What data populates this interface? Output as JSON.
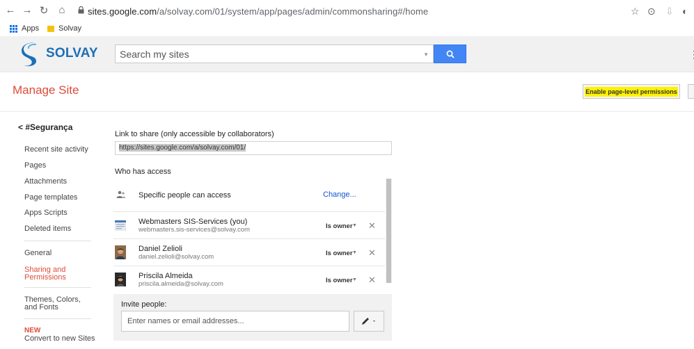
{
  "browser": {
    "url_host": "sites.google.com",
    "url_path": "/a/solvay.com/01/system/app/pages/admin/commonsharing#/home",
    "bookmarks": [
      {
        "label": "Apps"
      },
      {
        "label": "Solvay"
      }
    ]
  },
  "header": {
    "brand": "SOLVAY",
    "search_placeholder": "Search my sites"
  },
  "page": {
    "title": "Manage Site",
    "enable_permissions_label": "Enable page-level permissions"
  },
  "sidebar": {
    "back_label": "< #Segurança",
    "groups": [
      [
        "Recent site activity",
        "Pages",
        "Attachments",
        "Page templates",
        "Apps Scripts",
        "Deleted items"
      ],
      [
        "General",
        "Sharing and Permissions"
      ],
      [
        "Themes, Colors, and Fonts"
      ]
    ],
    "new_badge": "NEW",
    "convert_label": "Convert to new Sites"
  },
  "sharing": {
    "link_label": "Link to share (only accessible by collaborators)",
    "link_value": "https://sites.google.com/a/solvay.com/01/",
    "who_label": "Who has access",
    "visibility": "Specific people can access",
    "change_label": "Change...",
    "people": [
      {
        "name": "Webmasters SIS-Services (you)",
        "email": "webmasters.sis-services@solvay.com",
        "role": "Is owner"
      },
      {
        "name": "Daniel Zelioli",
        "email": "daniel.zelioli@solvay.com",
        "role": "Is owner"
      },
      {
        "name": "Priscila Almeida",
        "email": "priscila.almeida@solvay.com",
        "role": "Is owner"
      }
    ],
    "invite_label": "Invite people:",
    "invite_placeholder": "Enter names or email addresses..."
  },
  "colors": {
    "accent_red": "#dd4b39",
    "brand_blue": "#1d6fb8",
    "search_blue": "#4285f4",
    "highlight": "#fff200"
  }
}
